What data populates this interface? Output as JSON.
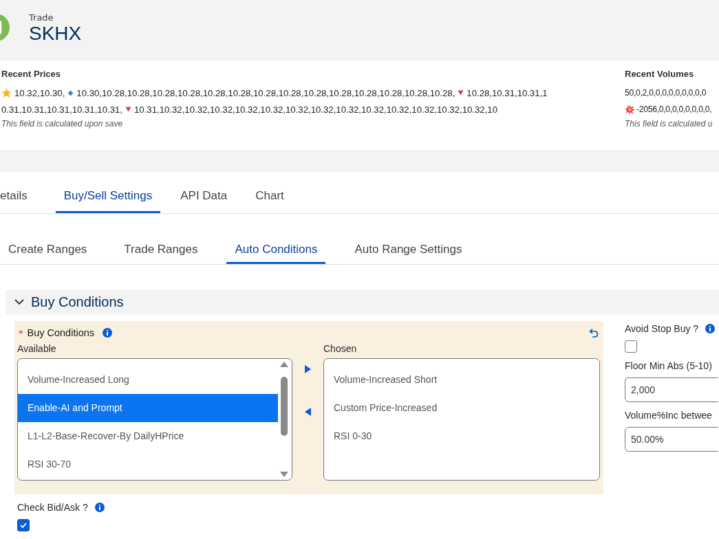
{
  "header": {
    "object_type": "Trade",
    "title": "SKHX"
  },
  "recent_prices": {
    "label": "Recent Prices",
    "lines": [
      [
        {
          "kind": "star",
          "text": "10.32,10.30,"
        },
        {
          "kind": "diamond",
          "text": "10.30,10.28,10.28,10.28,10.28,10.28,10.28,10.28,10.28,10.28,10.28,10.28,10.28,10.28,10.28,"
        },
        {
          "kind": "down",
          "text": "10.28,10.31,10.31,1"
        }
      ],
      [
        {
          "kind": "plain",
          "text": "0.31,10.31,10.31,10.31,10.31,"
        },
        {
          "kind": "down",
          "text": "10.31,10.32,10.32,10.32,10.32,10.32,10.32,10.32,10.32,10.32,10.32,10.32,10.32,10.32,10"
        }
      ]
    ],
    "help": "This field is calculated upon save"
  },
  "recent_volumes": {
    "label": "Recent Volumes",
    "lines": [
      [
        {
          "kind": "plain",
          "text": "50,0,2,0,0,0,0,0,0,0,0,0"
        }
      ],
      [
        {
          "kind": "burst",
          "text": "-2056,0,0,0,0,0,0,0,0,"
        }
      ]
    ],
    "help": "This field is calculated u"
  },
  "tabs": [
    {
      "label": "etails",
      "selected": false
    },
    {
      "label": "Buy/Sell Settings",
      "selected": true
    },
    {
      "label": "API Data",
      "selected": false
    },
    {
      "label": "Chart",
      "selected": false
    }
  ],
  "subtabs": [
    {
      "label": "Create Ranges",
      "selected": false
    },
    {
      "label": "Trade Ranges",
      "selected": false
    },
    {
      "label": "Auto Conditions",
      "selected": true
    },
    {
      "label": "Auto Range Settings",
      "selected": false
    }
  ],
  "section": {
    "title": "Buy Conditions",
    "expanded": true
  },
  "dual_list": {
    "label": "Buy Conditions",
    "required_mark": "*",
    "available_label": "Available",
    "available": [
      {
        "label": "Volume-Increased Long",
        "selected": false
      },
      {
        "label": "Enable-AI and Prompt",
        "selected": true
      },
      {
        "label": "L1-L2-Base-Recover-By DailyHPrice",
        "selected": false
      },
      {
        "label": "RSI 30-70",
        "selected": false
      }
    ],
    "chosen_label": "Chosen",
    "chosen": [
      {
        "label": "Volume-Increased Short",
        "selected": false
      },
      {
        "label": "Custom Price-Increased",
        "selected": false
      },
      {
        "label": "RSI 0-30",
        "selected": false
      }
    ]
  },
  "check_bid_ask": {
    "label": "Check Bid/Ask ?",
    "checked": true
  },
  "right_fields": [
    {
      "kind": "checkbox",
      "label": "Avoid Stop Buy ?",
      "info": true,
      "checked": false
    },
    {
      "kind": "input",
      "label": "Floor Min Abs (5-10)",
      "value": "2,000"
    },
    {
      "kind": "input",
      "label": "Volume%Inc betwee",
      "value": "50.00%"
    }
  ]
}
